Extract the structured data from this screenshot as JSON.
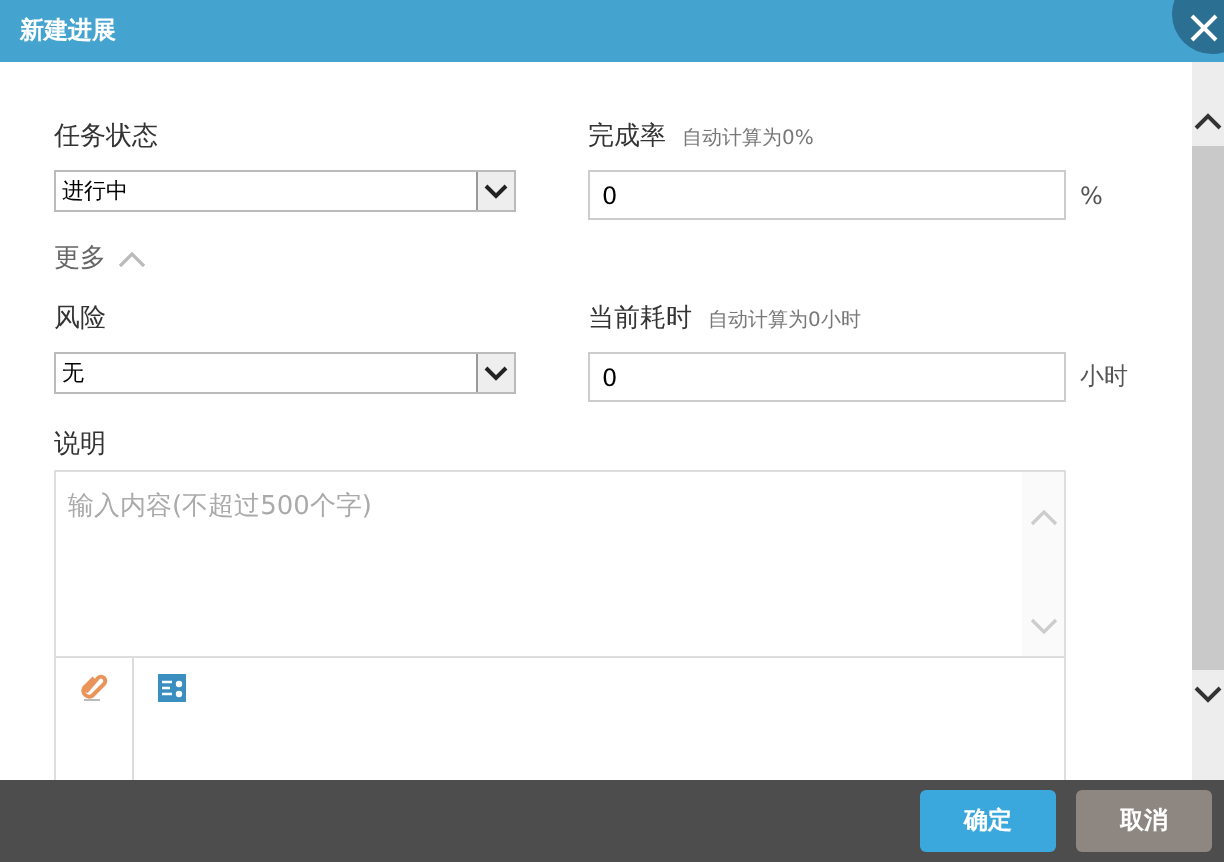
{
  "window": {
    "title": "新建进展"
  },
  "rows": [
    [
      {
        "kind": "select",
        "label": "任务状态",
        "value": "进行中"
      },
      {
        "kind": "input",
        "label": "完成率",
        "hint": "自动计算为0%",
        "value": "0",
        "unit": "%"
      }
    ],
    [
      {
        "kind": "select",
        "label": "风险",
        "value": "无"
      },
      {
        "kind": "input",
        "label": "当前耗时",
        "hint": "自动计算为0小时",
        "value": "0",
        "unit": "小时"
      }
    ]
  ],
  "more": {
    "label": "更多",
    "expanded": true
  },
  "description": {
    "label": "说明",
    "placeholder": "输入内容(不超过500个字)"
  },
  "buttons": [
    {
      "kind": "primary",
      "label": "确定"
    },
    {
      "kind": "secondary",
      "label": "取消"
    }
  ]
}
